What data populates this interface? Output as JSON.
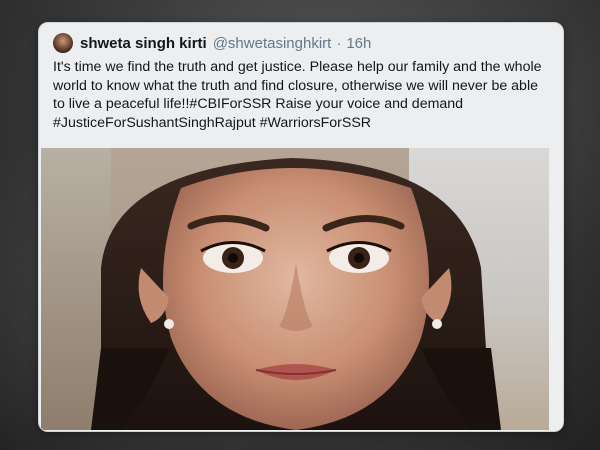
{
  "tweet": {
    "display_name": "shweta singh kirti",
    "handle": "@shwetasinghkirt",
    "separator": "·",
    "time": "16h",
    "text": "It's time we find the truth and get justice. Please help our family and the whole world to know what the truth and find closure, otherwise we will never be able to live a peaceful life!!#CBIForSSR Raise your voice and demand #JusticeForSushantSinghRajput #WarriorsForSSR"
  },
  "media": {
    "description_icon": "portrait-photo"
  },
  "colors": {
    "card_background": "#eceef0",
    "text_primary": "#14171a",
    "text_secondary": "#657786",
    "backdrop": "#3d3d3d"
  }
}
